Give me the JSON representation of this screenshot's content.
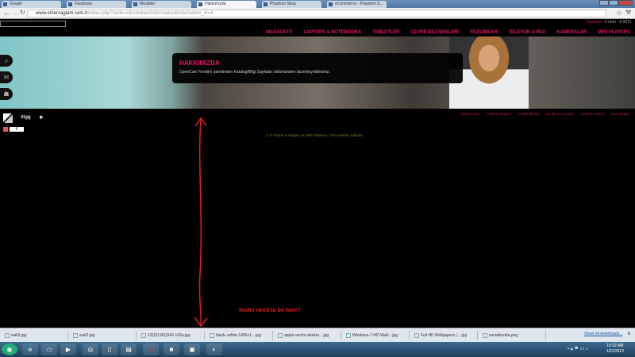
{
  "browser": {
    "tabs": [
      "Google",
      "Facebook",
      "Modüller",
      "Hakkımızda",
      "Phantom Skop",
      "eCommerce - Phantom S..."
    ],
    "active_tab": 3,
    "url_host": "www.omersaglam.com.tr",
    "url_path": "/index.php?route=information/information&information_id=4"
  },
  "header": {
    "cart_label": "Sepetiniz:",
    "cart_value": "0 ürün - 0.00TL",
    "nav": [
      "MASAÜSTÜ",
      "LAPTOPS & NOTEBOOKS",
      "TABLETLER",
      "ÇEVRE BİLEŞENLERİ",
      "YAZILIMLAR",
      "TELEFON & PDA",
      "KAMERALAR",
      "MP3 PLAYERS"
    ]
  },
  "info": {
    "title": "HAKKIMIZDA",
    "text": "OpenCart Yönetim panelinden Katalog/Bilgi Sayfaları bölümünden düzenleyebilirsiniz."
  },
  "social": {
    "count": "0",
    "digg": "digg"
  },
  "footer": {
    "links": [
      "Hakkımızda",
      "Teslimat Bilgileri",
      "Gizlilik İlkeleri",
      "Şartlar & Koşullar",
      "Ürünlük Kontrol",
      "Site Haritası"
    ],
    "copyright": "© E-Ticaret & Oluşan ve Web Tasarımı / Tüm Hakları Saklıdır."
  },
  "annotation": {
    "note": "footer need to be here?",
    "color": "#e02020"
  },
  "downloads": {
    "items": [
      "wall3.jpg",
      "wall2.jpg",
      "12Q0135Q340-142a.jpg",
      "black--white-1480x1....jpg",
      "apple-vector-deskto....jpg",
      "Windows-7-HD-Wall....jpg",
      "Full HD Wallpapers (....jpg",
      "socialmedia.png"
    ],
    "show_all": "Show all downloads..."
  },
  "taskbar": {
    "time": "10:32 AM",
    "date": "1/31/2012"
  },
  "colors": {
    "accent": "#e0166a"
  }
}
